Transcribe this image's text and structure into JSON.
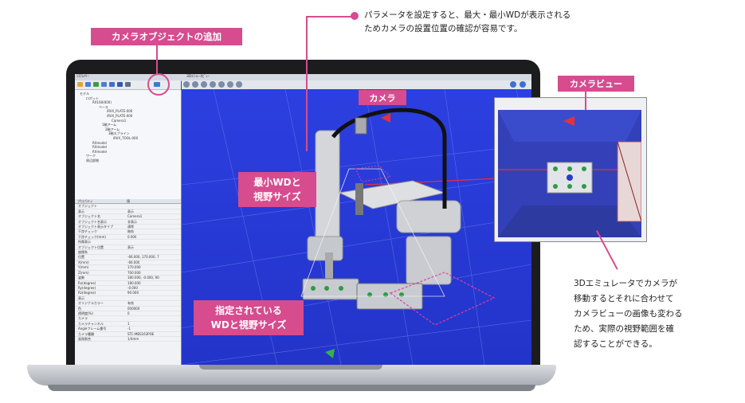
{
  "callouts": {
    "add_camera": "カメラオブジェクトの追加",
    "parameter_note_line1": "パラメータを設定すると、最大・最小WDが表示される",
    "parameter_note_line2": "ためカメラの設置位置の確認が容易です。",
    "camera": "カメラ",
    "camera_view": "カメラビュー",
    "min_wd_line1": "最小WDと",
    "min_wd_line2": "視野サイズ",
    "specified_wd_line1": "指定されている",
    "specified_wd_line2": "WDと視野サイズ",
    "emulator_note": [
      "3Dエミュレータでカメラが",
      "移動するとそれに合わせて",
      "カメラビューの画像も変わる",
      "ため、実際の視野範囲を確",
      "認することができる。"
    ]
  },
  "colors": {
    "accent_pink": "#d64c8f",
    "viewport_blue": "#2c3fe0",
    "laptop_bezel": "#1c1c1e"
  },
  "app": {
    "left_panel_title": "ｼｽﾃﾑﾂﾘｰ",
    "right_panel_title": "3Dｴﾐｭﾚｰﾀﾋﾞｭｰ",
    "tree_items": [
      "モデル",
      "ロボット",
      "RX160(600)",
      "ベース",
      "iRVX_PLATE-000",
      "iRVX_PLATE-000",
      "Camera1",
      "1軸アーム",
      "2軸アーム",
      "3軸スプライン",
      "iRVX_TOOL-000",
      "RXmodel",
      "RXmodel",
      "RXmodel",
      "ワーク",
      "周辺部物"
    ],
    "props_header": [
      "プロパティ",
      "値"
    ],
    "props_rows": [
      [
        "オブジェクト",
        ""
      ],
      [
        "表示",
        "表示"
      ],
      [
        "オブジェクト名",
        "Camera1"
      ],
      [
        "オブジェクト名表示",
        "非表示"
      ],
      [
        "オブジェクト表示タイプ",
        "通常"
      ],
      [
        "干渉チェック",
        "無効"
      ],
      [
        "干渉チェック(mm)",
        "0.000"
      ],
      [
        "所属表示",
        ""
      ],
      [
        "オブジェクト位置",
        "表示"
      ],
      [
        "座標系",
        ""
      ],
      [
        "位置",
        "-66.000, 170.000, 7"
      ],
      [
        "X(mm)",
        "-66.000"
      ],
      [
        "Y(mm)",
        "170.000"
      ],
      [
        "Z(mm)",
        "700.000"
      ],
      [
        "姿勢",
        "180.000, -0.000, 90"
      ],
      [
        "Rx(degree)",
        "180.000"
      ],
      [
        "Ry(degree)",
        "-0.000"
      ],
      [
        "Rz(degree)",
        "90.000"
      ],
      [
        "表示",
        ""
      ],
      [
        "オリジナルカラー",
        "有効"
      ],
      [
        "色",
        "000000"
      ],
      [
        "透明度(%)",
        "0"
      ],
      [
        "カメラ",
        ""
      ],
      [
        "カメラチャンネル",
        "1"
      ],
      [
        "Angleフレーム番号",
        "-1"
      ],
      [
        "カメラ種類",
        "STC-MBS163POE"
      ],
      [
        "画角割合",
        "1/4mm"
      ]
    ]
  }
}
